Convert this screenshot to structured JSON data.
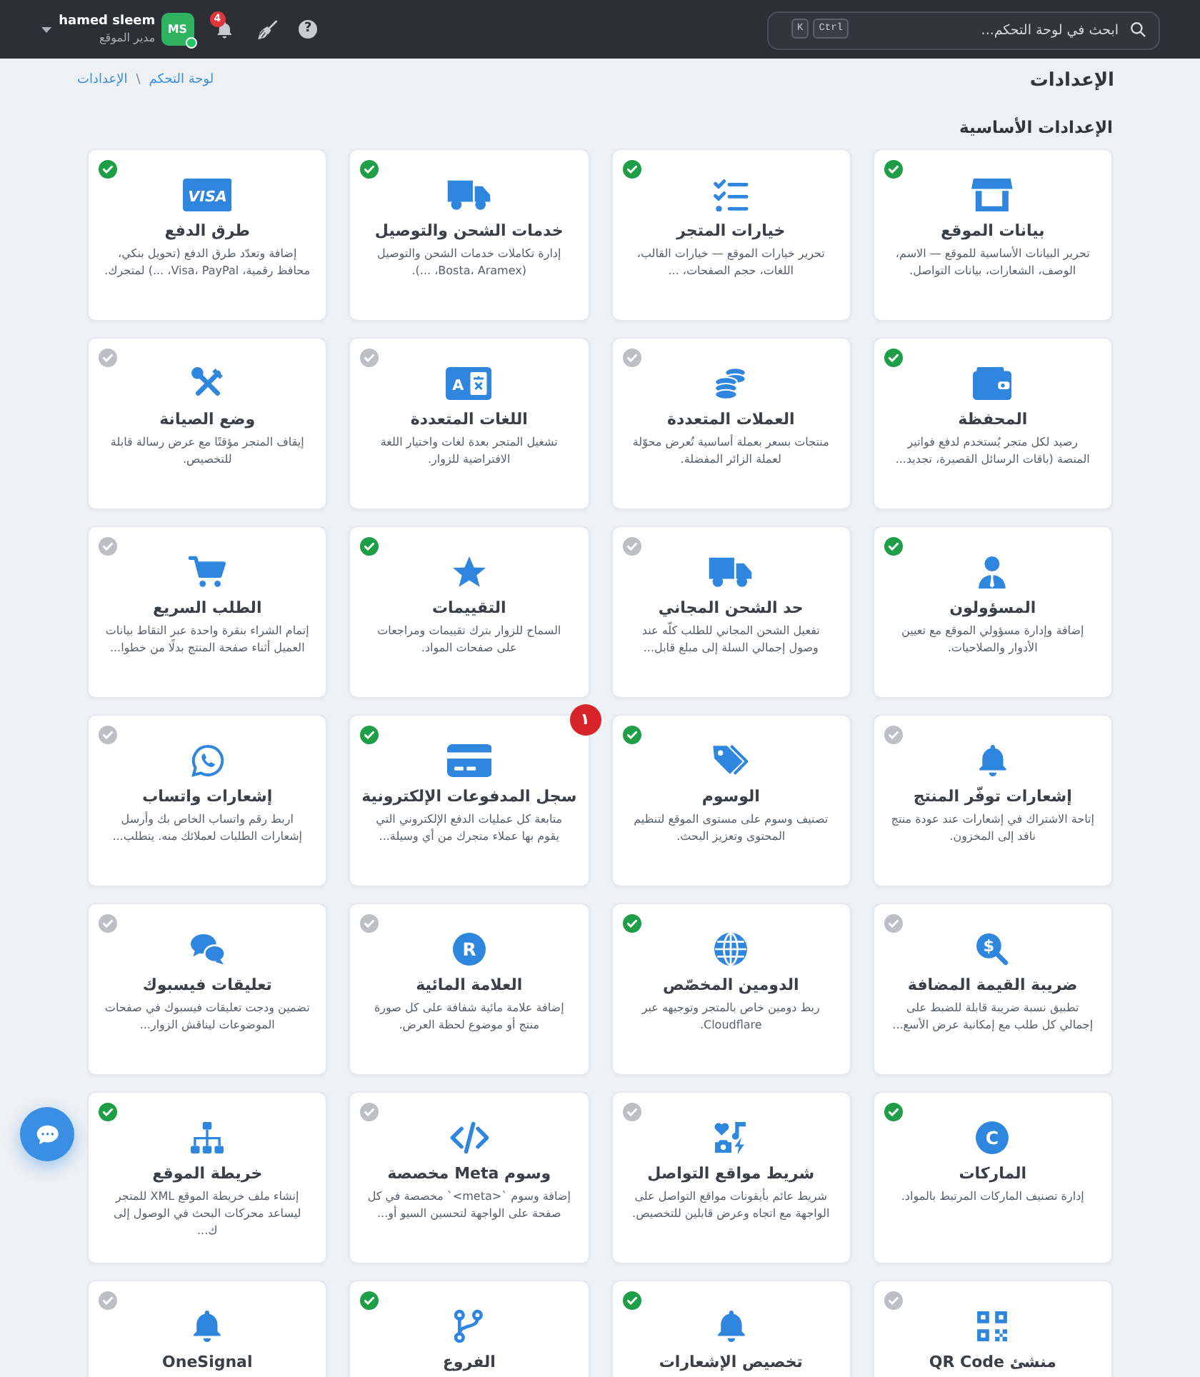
{
  "header": {
    "search": {
      "placeholder": "ابحث في لوحة التحكم...",
      "keys": [
        "Ctrl",
        "K"
      ]
    },
    "help": "?",
    "notification_count": "4",
    "user": {
      "name": "hamed sleem",
      "role": "مدير الموقع",
      "initials": "MS",
      "online": true
    }
  },
  "breadcrumb": [
    {
      "label": "لوحة التحكم"
    },
    {
      "label": "الإعدادات"
    }
  ],
  "breadcrumb_separator": "\\",
  "page_title": "الإعدادات",
  "section_title": "الإعدادات الأساسية",
  "cards": [
    {
      "title": "بيانات الموقع",
      "description": "تحرير البيانات الأساسية للموقع — الاسم، الوصف، الشعارات، بيانات التواصل.",
      "enabled": true
    },
    {
      "title": "خيارات المتجر",
      "description": "تحرير خيارات الموقع — خيارات القالب، اللغات، حجم الصفحات، ...",
      "enabled": true
    },
    {
      "title": "خدمات الشحن والتوصيل",
      "description": "إدارة تكاملات خدمات الشحن والتوصيل (Bosta، Aramex، ...).",
      "enabled": true
    },
    {
      "title": "طرق الدفع",
      "description": "إضافة وتعدّد طرق الدفع (تحويل بنكي، محافظ رقمية، Visa، PayPal، ...) لمتجرك.",
      "enabled": true,
      "icon_text": "VISA"
    },
    {
      "title": "المحفظة",
      "description": "رصيد لكل متجر يُستخدم لدفع فواتير المنصة (باقات الرسائل القصيرة، تجديد...",
      "enabled": true
    },
    {
      "title": "العملات المتعددة",
      "description": "منتجات بسعر بعملة أساسية تُعرض محوّلة لعملة الزائر المفضلة.",
      "enabled": false
    },
    {
      "title": "اللغات المتعددة",
      "description": "تشغيل المتجر بعدة لغات واختيار اللغة الافتراضية للزوار.",
      "enabled": false,
      "icon_text": "A"
    },
    {
      "title": "وضع الصيانة",
      "description": "إيقاف المتجر مؤقتًا مع عرض رسالة قابلة للتخصيص.",
      "enabled": false
    },
    {
      "title": "المسؤولون",
      "description": "إضافة وإدارة مسؤولي الموقع مع تعيين الأدوار والصلاحيات.",
      "enabled": true
    },
    {
      "title": "حد الشحن المجاني",
      "description": "تفعيل الشحن المجاني للطلب كلّه عند وصول إجمالي السلة إلى مبلغ قابل...",
      "enabled": false
    },
    {
      "title": "التقييمات",
      "description": "السماح للزوار بترك تقييمات ومراجعات على صفحات المواد.",
      "enabled": true
    },
    {
      "title": "الطلب السريع",
      "description": "إتمام الشراء بنقرة واحدة عبر التقاط بيانات العميل أثناء صفحة المنتج بدلًا من خطوا...",
      "enabled": false
    },
    {
      "title": "إشعارات توفّر المنتج",
      "description": "إتاحة الاشتراك في إشعارات عند عودة منتج نافد إلى المخزون.",
      "enabled": false
    },
    {
      "title": "الوسوم",
      "description": "تصنيف وسوم على مستوى الموقع لتنظيم المحتوى وتعزيز البحث.",
      "enabled": true
    },
    {
      "title": "سجل المدفوعات الإلكترونية",
      "description": "متابعة كل عمليات الدفع الإلكتروني التي يقوم بها عملاء متجرك من أي وسيلة...",
      "enabled": true,
      "badge": "١"
    },
    {
      "title": "إشعارات واتساب",
      "description": "اربط رقم واتساب الخاص بك وأرسل إشعارات الطلبات لعملائك منه. يتطلب...",
      "enabled": false
    },
    {
      "title": "ضريبة القيمة المضافة",
      "description": "تطبيق نسبة ضريبة قابلة للضبط على إجمالي كل طلب مع إمكانية عرض الأسع...",
      "enabled": false,
      "icon_text": "$"
    },
    {
      "title": "الدومين المخصّص",
      "description": "ربط دومين خاص بالمتجر وتوجيهه عبر Cloudflare.",
      "enabled": true
    },
    {
      "title": "العلامة المائية",
      "description": "إضافة علامة مائية شفافة على كل صورة منتج أو موضوع لحظة العرض.",
      "enabled": false,
      "icon_text": "R"
    },
    {
      "title": "تعليقات فيسبوك",
      "description": "تضمين ودجت تعليقات فيسبوك في صفحات الموضوعات ليناقش الزوار...",
      "enabled": false
    },
    {
      "title": "الماركات",
      "description": "إدارة تصنيف الماركات المرتبط بالمواد.",
      "enabled": true,
      "icon_text": "C"
    },
    {
      "title": "شريط مواقع التواصل",
      "description": "شريط عائم بأيقونات مواقع التواصل على الواجهة مع اتجاه وعرض قابلين للتخصيص.",
      "enabled": false
    },
    {
      "title": "وسوم Meta مخصصة",
      "description": "إضافة وسوم `<meta>` مخصصة في كل صفحة على الواجهة لتحسين السيو أو...",
      "enabled": false
    },
    {
      "title": "خريطة الموقع",
      "description": "إنشاء ملف خريطة الموقع XML للمتجر ليساعد محركات البحث في الوصول إلى ك...",
      "enabled": true
    },
    {
      "title": "منشئ QR Code",
      "enabled": false
    },
    {
      "title": "تخصيص الإشعارات",
      "enabled": true
    },
    {
      "title": "الفروع",
      "enabled": true
    },
    {
      "title": "OneSignal",
      "enabled": false
    }
  ]
}
